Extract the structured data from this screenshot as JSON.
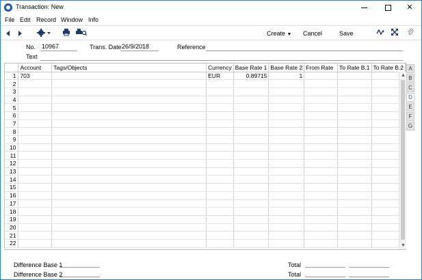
{
  "window": {
    "title": "Transaction: New"
  },
  "menu": [
    "File",
    "Edit",
    "Record",
    "Window",
    "Info"
  ],
  "toolbar": {
    "create_label": "Create",
    "cancel_label": "Cancel",
    "save_label": "Save"
  },
  "header": {
    "no_label": "No.",
    "no_value": "10967",
    "date_label": "Trans. Date",
    "date_value": "26/9/2018",
    "reference_label": "Reference",
    "reference_value": "",
    "text_label": "Text",
    "text_value": ""
  },
  "grid": {
    "columns": [
      "",
      "Account",
      "Tags/Objects",
      "Currency",
      "Base Rate 1",
      "Base Rate 2",
      "From Rate",
      "To Rate B.1",
      "To Rate B.2"
    ],
    "rows": [
      [
        "1",
        "703",
        "",
        "EUR",
        "0.89715",
        "1",
        "",
        "",
        ""
      ],
      [
        "2",
        "",
        "",
        "",
        "",
        "",
        "",
        "",
        ""
      ],
      [
        "3",
        "",
        "",
        "",
        "",
        "",
        "",
        "",
        ""
      ],
      [
        "4",
        "",
        "",
        "",
        "",
        "",
        "",
        "",
        ""
      ],
      [
        "5",
        "",
        "",
        "",
        "",
        "",
        "",
        "",
        ""
      ],
      [
        "6",
        "",
        "",
        "",
        "",
        "",
        "",
        "",
        ""
      ],
      [
        "7",
        "",
        "",
        "",
        "",
        "",
        "",
        "",
        ""
      ],
      [
        "8",
        "",
        "",
        "",
        "",
        "",
        "",
        "",
        ""
      ],
      [
        "9",
        "",
        "",
        "",
        "",
        "",
        "",
        "",
        ""
      ],
      [
        "10",
        "",
        "",
        "",
        "",
        "",
        "",
        "",
        ""
      ],
      [
        "11",
        "",
        "",
        "",
        "",
        "",
        "",
        "",
        ""
      ],
      [
        "12",
        "",
        "",
        "",
        "",
        "",
        "",
        "",
        ""
      ],
      [
        "13",
        "",
        "",
        "",
        "",
        "",
        "",
        "",
        ""
      ],
      [
        "14",
        "",
        "",
        "",
        "",
        "",
        "",
        "",
        ""
      ],
      [
        "15",
        "",
        "",
        "",
        "",
        "",
        "",
        "",
        ""
      ],
      [
        "16",
        "",
        "",
        "",
        "",
        "",
        "",
        "",
        ""
      ],
      [
        "17",
        "",
        "",
        "",
        "",
        "",
        "",
        "",
        ""
      ],
      [
        "18",
        "",
        "",
        "",
        "",
        "",
        "",
        "",
        ""
      ],
      [
        "19",
        "",
        "",
        "",
        "",
        "",
        "",
        "",
        ""
      ],
      [
        "20",
        "",
        "",
        "",
        "",
        "",
        "",
        "",
        ""
      ],
      [
        "21",
        "",
        "",
        "",
        "",
        "",
        "",
        "",
        ""
      ],
      [
        "22",
        "",
        "",
        "",
        "",
        "",
        "",
        "",
        ""
      ]
    ]
  },
  "tabs": [
    {
      "label": "A",
      "active": false
    },
    {
      "label": "B",
      "active": false
    },
    {
      "label": "C",
      "active": false
    },
    {
      "label": "D",
      "active": true
    },
    {
      "label": "E",
      "active": false
    },
    {
      "label": "F",
      "active": false
    },
    {
      "label": "G",
      "active": false
    }
  ],
  "footer": {
    "diff_base1_label": "Difference Base 1",
    "diff_base2_label": "Difference Base 2",
    "total1_label": "Total",
    "total2_label": "Total"
  },
  "colors": {
    "accent": "#2b7cd3",
    "icon": "#1e3a6b"
  }
}
